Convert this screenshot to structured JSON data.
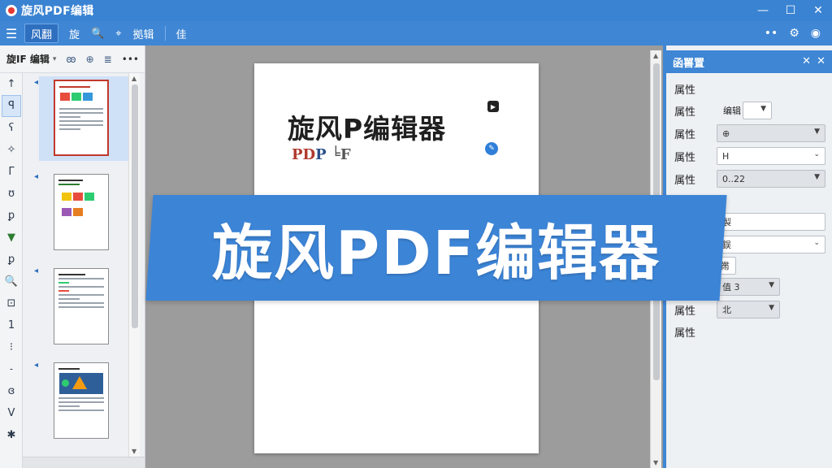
{
  "window": {
    "title": "旋风PDF编辑",
    "min_icon": "—",
    "max_icon": "☐",
    "close_icon": "✕"
  },
  "toolbar": {
    "menu_icon": "☰",
    "tab_active": "风翻",
    "item_1": "旋",
    "search_icon": "🔍",
    "tool_icon": "⌖",
    "item_2": "拠辑",
    "item_3": "佳",
    "more_icon": "••",
    "settings_icon": "⚙",
    "user_icon": "◉"
  },
  "thumbnail_panel": {
    "title": "旋IF 编辑",
    "dropdown": "▾",
    "icon_a": "ꙭ",
    "icon_b": "⊕",
    "icon_c": "≣",
    "more": "•••",
    "pages": [
      {
        "selected": true
      },
      {
        "selected": false
      },
      {
        "selected": false
      },
      {
        "selected": false
      }
    ]
  },
  "tools": [
    "↑",
    "ꟼ",
    "ʕ",
    "✧",
    "Γ",
    "ʊ",
    "ꝑ",
    "▼",
    "ꝑ",
    "🔍",
    "⊡",
    "1",
    "⁝",
    "˗",
    "ɞ",
    "V",
    "✱"
  ],
  "document": {
    "heading": "旋风P编辑器",
    "sub_r": "PD",
    "sub_b": "P",
    "sub_g": "╘F",
    "mini_icon": "▶",
    "edit_icon": "✎"
  },
  "props_panel": {
    "title": "函嘼置",
    "pin_icon": "✕",
    "close_icon": "✕",
    "section_label": "属性",
    "rows": [
      {
        "label": "属性",
        "prefix": "编辑",
        "value": "",
        "type": "small-dropdown"
      },
      {
        "label": "属性",
        "value": "⊕",
        "type": "dropdown-gray"
      },
      {
        "label": "属性",
        "value": "H",
        "type": "dropdown"
      },
      {
        "label": "属性",
        "value": "0..22",
        "type": "dropdown-gray"
      },
      {
        "label": "属性",
        "value": "",
        "type": "header"
      },
      {
        "label": "",
        "value": "製",
        "type": "input"
      },
      {
        "label": "",
        "value": "鋘",
        "type": "dropdown"
      },
      {
        "label": "",
        "value": "黹",
        "type": "button"
      },
      {
        "label": "属性",
        "value": "值 3",
        "type": "small-dropdown-gray"
      },
      {
        "label": "属性",
        "value": "北",
        "type": "small-dropdown-gray"
      },
      {
        "label": "属性",
        "value": "",
        "type": "header"
      }
    ]
  },
  "banner": {
    "text": "旋风PDF编辑器"
  }
}
